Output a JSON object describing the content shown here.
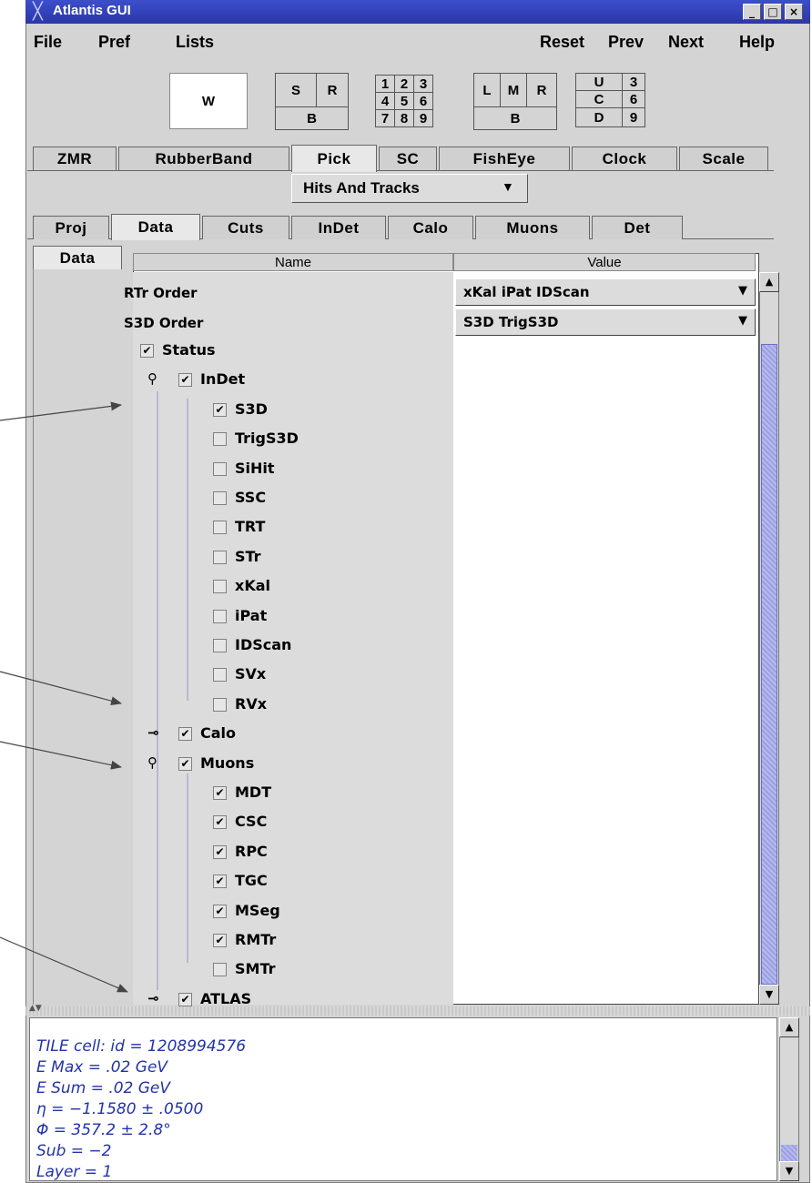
{
  "window": {
    "title": "Atlantis GUI",
    "minimize": "_",
    "maximize": "□",
    "close": "×"
  },
  "menubar": {
    "file": "File",
    "pref": "Pref",
    "lists": "Lists",
    "reset": "Reset",
    "prev": "Prev",
    "next": "Next",
    "help": "Help"
  },
  "window_control": {
    "w": "W",
    "s": "S",
    "r": "R",
    "b1": "B",
    "nums": [
      "1",
      "2",
      "3",
      "4",
      "5",
      "6",
      "7",
      "8",
      "9"
    ],
    "l": "L",
    "m": "M",
    "r2": "R",
    "b2": "B",
    "u": "U",
    "c": "C",
    "d": "D",
    "u3": "3",
    "c6": "6",
    "d9": "9"
  },
  "interaction_tabs": [
    "ZMR",
    "RubberBand",
    "Pick",
    "SC",
    "FishEye",
    "Clock",
    "Scale"
  ],
  "pick_mode": {
    "value": "Hits And Tracks",
    "arrow": "▼"
  },
  "param_tabs": [
    "Proj",
    "Data",
    "Cuts",
    "InDet",
    "Calo",
    "Muons",
    "Det"
  ],
  "side_tab": "Data",
  "table": {
    "header_name": "Name",
    "header_value": "Value",
    "rtr_label": "RTr Order",
    "rtr_value": "xKal iPat IDScan",
    "s3d_label": "S3D Order",
    "s3d_value": "S3D TrigS3D",
    "combo_arrow": "▼",
    "check": "✔",
    "expanded_icon": "⚲",
    "collapsed_icon": "⊸",
    "tree": [
      {
        "label": "Status",
        "checked": true
      },
      {
        "label": "InDet",
        "checked": true
      },
      {
        "label": "S3D",
        "checked": true
      },
      {
        "label": "TrigS3D",
        "checked": false
      },
      {
        "label": "SiHit",
        "checked": false
      },
      {
        "label": "SSC",
        "checked": false
      },
      {
        "label": "TRT",
        "checked": false
      },
      {
        "label": "STr",
        "checked": false
      },
      {
        "label": "xKal",
        "checked": false
      },
      {
        "label": "iPat",
        "checked": false
      },
      {
        "label": "IDScan",
        "checked": false
      },
      {
        "label": "SVx",
        "checked": false
      },
      {
        "label": "RVx",
        "checked": false
      },
      {
        "label": "Calo",
        "checked": true
      },
      {
        "label": "Muons",
        "checked": true
      },
      {
        "label": "MDT",
        "checked": true
      },
      {
        "label": "CSC",
        "checked": true
      },
      {
        "label": "RPC",
        "checked": true
      },
      {
        "label": "TGC",
        "checked": true
      },
      {
        "label": "MSeg",
        "checked": true
      },
      {
        "label": "RMTr",
        "checked": true
      },
      {
        "label": "SMTr",
        "checked": false
      },
      {
        "label": "ATLAS",
        "checked": true
      }
    ]
  },
  "scroll": {
    "up": "▲",
    "down": "▼"
  },
  "info_lines": [
    "TILE cell: id = 1208994576",
    " E Max = .02 GeV",
    " E Sum = .02 GeV",
    " η = −1.1580 ± .0500",
    " Φ = 357.2 ± 2.8°",
    " Sub = −2",
    " Layer = 1"
  ]
}
